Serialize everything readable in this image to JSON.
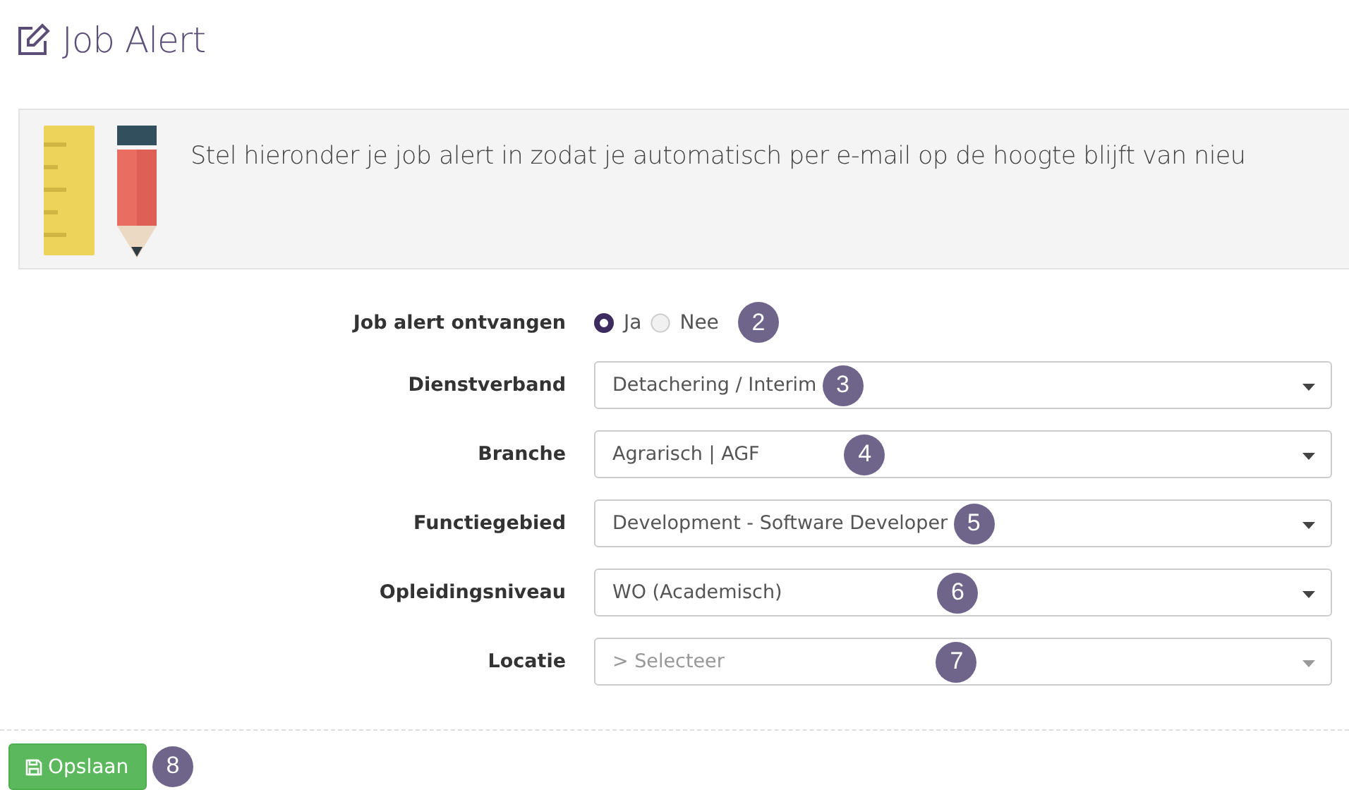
{
  "page": {
    "title": "Job Alert"
  },
  "banner": {
    "text": "Stel hieronder je job alert in zodat je automatisch per e-mail op de hoogte blijft van nieu"
  },
  "form": {
    "rows": [
      {
        "kind": "radio",
        "label": "Job alert ontvangen",
        "options": [
          {
            "label": "Ja",
            "selected": true
          },
          {
            "label": "Nee",
            "selected": false
          }
        ],
        "marker": "2"
      },
      {
        "kind": "select",
        "label": "Dienstverband",
        "value": "Detachering / Interim",
        "marker": "3"
      },
      {
        "kind": "select",
        "label": "Branche",
        "value": "Agrarisch | AGF",
        "marker": "4"
      },
      {
        "kind": "select",
        "label": "Functiegebied",
        "value": "Development - Software Developer",
        "marker": "5"
      },
      {
        "kind": "select",
        "label": "Opleidingsniveau",
        "value": "WO (Academisch)",
        "marker": "6"
      },
      {
        "kind": "select",
        "label": "Locatie",
        "placeholder": "> Selecteer",
        "marker": "7"
      }
    ]
  },
  "save_button": {
    "label": "Opslaan",
    "marker": "8"
  }
}
